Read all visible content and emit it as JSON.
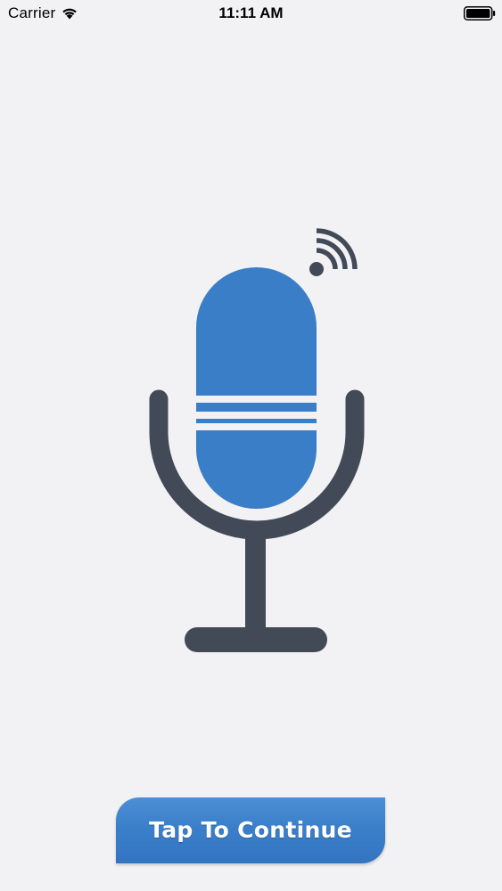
{
  "status_bar": {
    "carrier": "Carrier",
    "time": "11:11 AM",
    "wifi_icon": "wifi-icon",
    "battery_icon": "battery-full-icon"
  },
  "illustration": {
    "icon": "microphone-icon",
    "accent_icon": "broadcast-signal-icon",
    "colors": {
      "capsule": "#3a7ec7",
      "stand": "#414a56"
    }
  },
  "continue_button": {
    "label": "Tap To Continue",
    "color": "#3b7fca"
  },
  "background_color": "#f2f2f4"
}
